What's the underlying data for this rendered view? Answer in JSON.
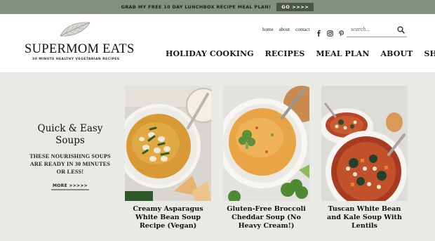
{
  "announcement": {
    "text": "GRAB MY FREE 10 DAY LUNCHBOX RECIPE MEAL PLAN!",
    "button": "GO >>>>"
  },
  "logo": {
    "title": "SUPERMOM EATS",
    "tagline": "30 MINUTE HEALTHY VEGETARIAN RECIPES"
  },
  "utility_links": [
    "home",
    "about",
    "contact"
  ],
  "social_icons": [
    "facebook-icon",
    "instagram-icon",
    "pinterest-icon"
  ],
  "search": {
    "placeholder": "search..."
  },
  "nav": [
    "HOLIDAY COOKING",
    "RECIPES",
    "MEAL PLAN",
    "ABOUT",
    "SHOP"
  ],
  "promo": {
    "title": "Quick & Easy Soups",
    "text": "THESE NOURISHING SOUPS ARE READY IN 30 MINUTES OR LESS!",
    "more": "MORE >>>>>"
  },
  "cards": [
    {
      "title": "Creamy Asparagus White Bean Soup Recipe (Vegan)"
    },
    {
      "title": "Gluten-Free Broccoli Cheddar Soup (No Heavy Cream!)"
    },
    {
      "title": "Tuscan White Bean and Kale Soup With Lentils"
    }
  ],
  "colors": {
    "topbar_bg": "#84907f",
    "topbar_button": "#4b5646",
    "content_bg": "#e9eae6"
  }
}
